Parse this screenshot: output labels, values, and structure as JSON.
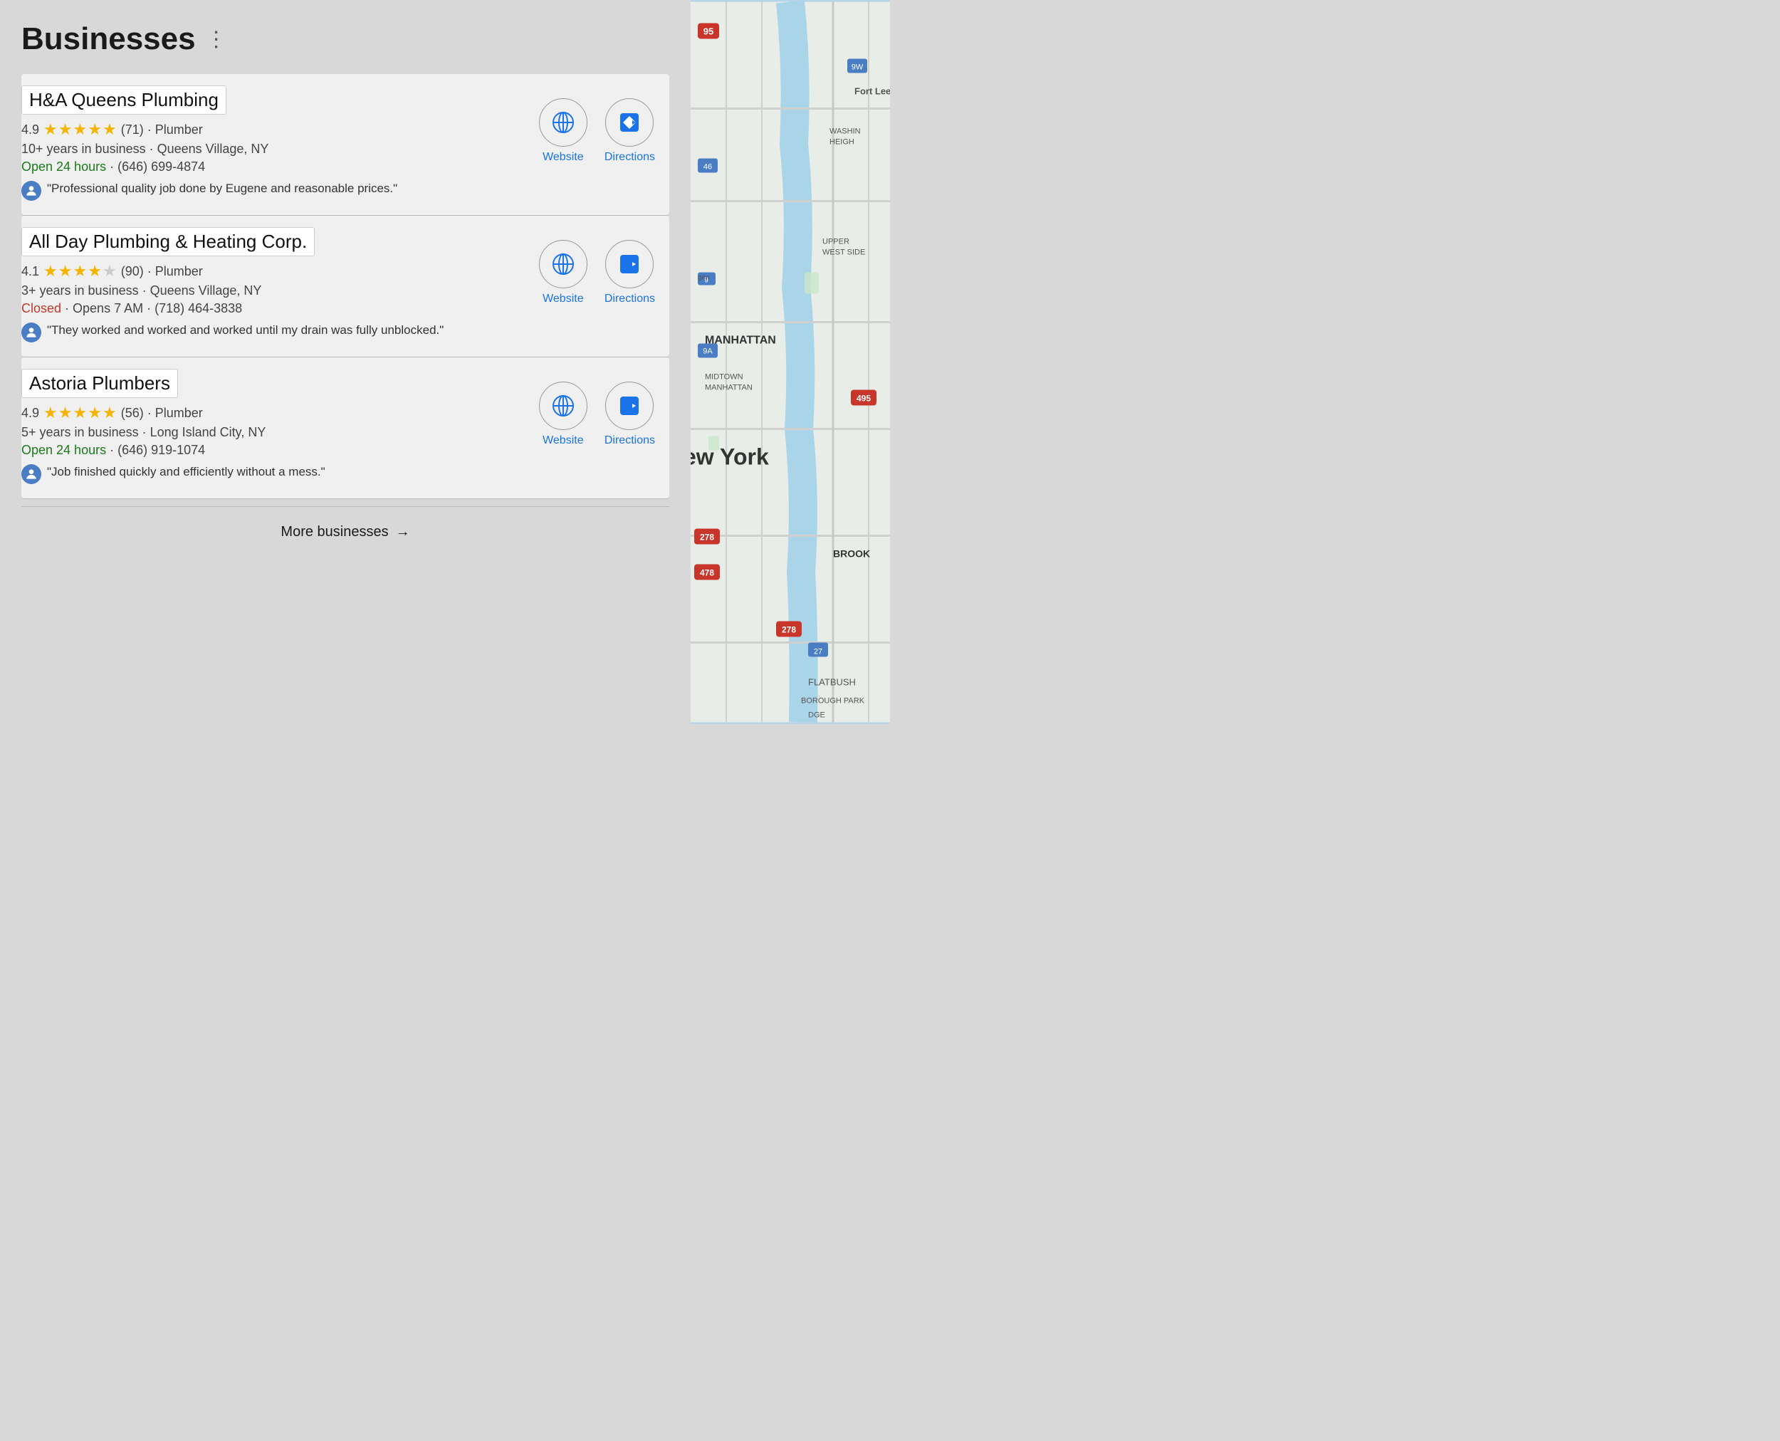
{
  "page": {
    "title": "Businesses",
    "menu_dots": "⋮"
  },
  "businesses": [
    {
      "id": 1,
      "name": "H&A Queens Plumbing",
      "rating": 4.9,
      "rating_count": 71,
      "type": "Plumber",
      "years": "10+ years in business",
      "location": "Queens Village, NY",
      "status": "open",
      "status_text": "Open 24 hours",
      "phone": "(646) 699-4874",
      "review": "\"Professional quality job done by Eugene and reasonable prices.\"",
      "stars_full": 5,
      "stars_empty": 0
    },
    {
      "id": 2,
      "name": "All Day Plumbing & Heating Corp.",
      "rating": 4.1,
      "rating_count": 90,
      "type": "Plumber",
      "years": "3+ years in business",
      "location": "Queens Village, NY",
      "status": "closed",
      "status_text": "Closed",
      "opens_text": "Opens 7 AM",
      "phone": "(718) 464-3838",
      "review": "\"They worked and worked and worked until my drain was fully unblocked.\"",
      "stars_full": 4,
      "stars_empty": 1
    },
    {
      "id": 3,
      "name": "Astoria Plumbers",
      "rating": 4.9,
      "rating_count": 56,
      "type": "Plumber",
      "years": "5+ years in business",
      "location": "Long Island City, NY",
      "status": "open",
      "status_text": "Open 24 hours",
      "phone": "(646) 919-1074",
      "review": "\"Job finished quickly and efficiently without a mess.\"",
      "stars_full": 5,
      "stars_empty": 0
    }
  ],
  "actions": {
    "website_label": "Website",
    "directions_label": "Directions"
  },
  "footer": {
    "more_label": "More businesses",
    "arrow": "→"
  }
}
